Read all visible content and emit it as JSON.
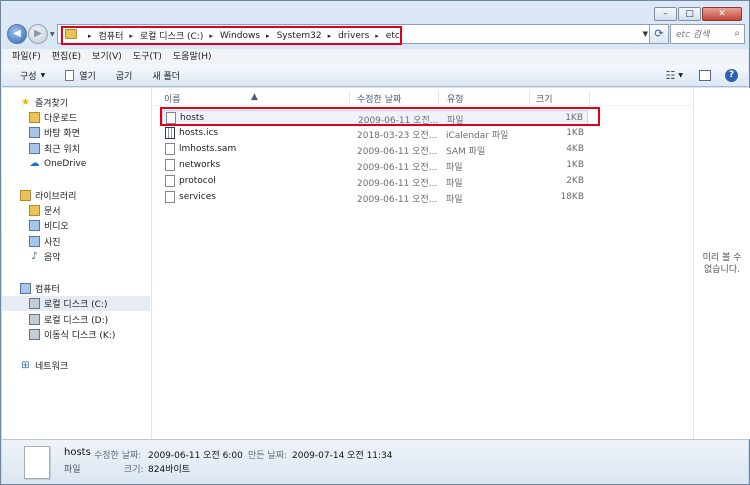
{
  "window": {
    "minimize_glyph": "–",
    "maximize_glyph": "□",
    "close_glyph": "✕"
  },
  "address_bar": {
    "crumbs": [
      "컴퓨터",
      "로컬 디스크 (C:)",
      "Windows",
      "System32",
      "drivers",
      "etc"
    ],
    "separator": "▸",
    "search_placeholder": "etc 검색"
  },
  "menu": [
    "파일(F)",
    "편집(E)",
    "보기(V)",
    "도구(T)",
    "도움말(H)"
  ],
  "toolbar": {
    "organize": "구성",
    "open": "열기",
    "share": "굽기",
    "new_folder": "새 폴더"
  },
  "nav": {
    "favorites": {
      "label": "즐겨찾기",
      "items": [
        "다운로드",
        "바탕 화면",
        "최근 위치",
        "OneDrive"
      ]
    },
    "libraries": {
      "label": "라이브러리",
      "items": [
        "문서",
        "비디오",
        "사진",
        "음악"
      ]
    },
    "computer": {
      "label": "컴퓨터",
      "items": [
        "로컬 디스크 (C:)",
        "로컬 디스크 (D:)",
        "이동식 디스크 (K:)"
      ]
    },
    "network": {
      "label": "네트워크"
    }
  },
  "columns": {
    "name": "이름",
    "date": "수정한 날짜",
    "type": "유형",
    "size": "크기"
  },
  "files": [
    {
      "name": "hosts",
      "date": "2009-06-11 오전...",
      "type": "파일",
      "size": "1KB",
      "icon": "file-icon"
    },
    {
      "name": "hosts.ics",
      "date": "2018-03-23 오전...",
      "type": "iCalendar 파일",
      "size": "1KB",
      "icon": "calendar-file-icon"
    },
    {
      "name": "lmhosts.sam",
      "date": "2009-06-11 오전...",
      "type": "SAM 파일",
      "size": "4KB",
      "icon": "file-icon"
    },
    {
      "name": "networks",
      "date": "2009-06-11 오전...",
      "type": "파일",
      "size": "1KB",
      "icon": "file-icon"
    },
    {
      "name": "protocol",
      "date": "2009-06-11 오전...",
      "type": "파일",
      "size": "2KB",
      "icon": "file-icon"
    },
    {
      "name": "services",
      "date": "2009-06-11 오전...",
      "type": "파일",
      "size": "18KB",
      "icon": "file-icon"
    }
  ],
  "preview": {
    "message_line1": "미리 볼 수",
    "message_line2": "없습니다."
  },
  "details": {
    "name": "hosts",
    "type": "파일",
    "modified_label": "수정한 날짜:",
    "modified_value": "2009-06-11 오전 6:00",
    "created_label": "만든 날짜:",
    "created_value": "2009-07-14 오전 11:34",
    "size_label": "크기:",
    "size_value": "824바이트"
  },
  "colors": {
    "highlight": "#e0001b",
    "selection": "#eef3fa",
    "accent": "#2d62b5"
  }
}
